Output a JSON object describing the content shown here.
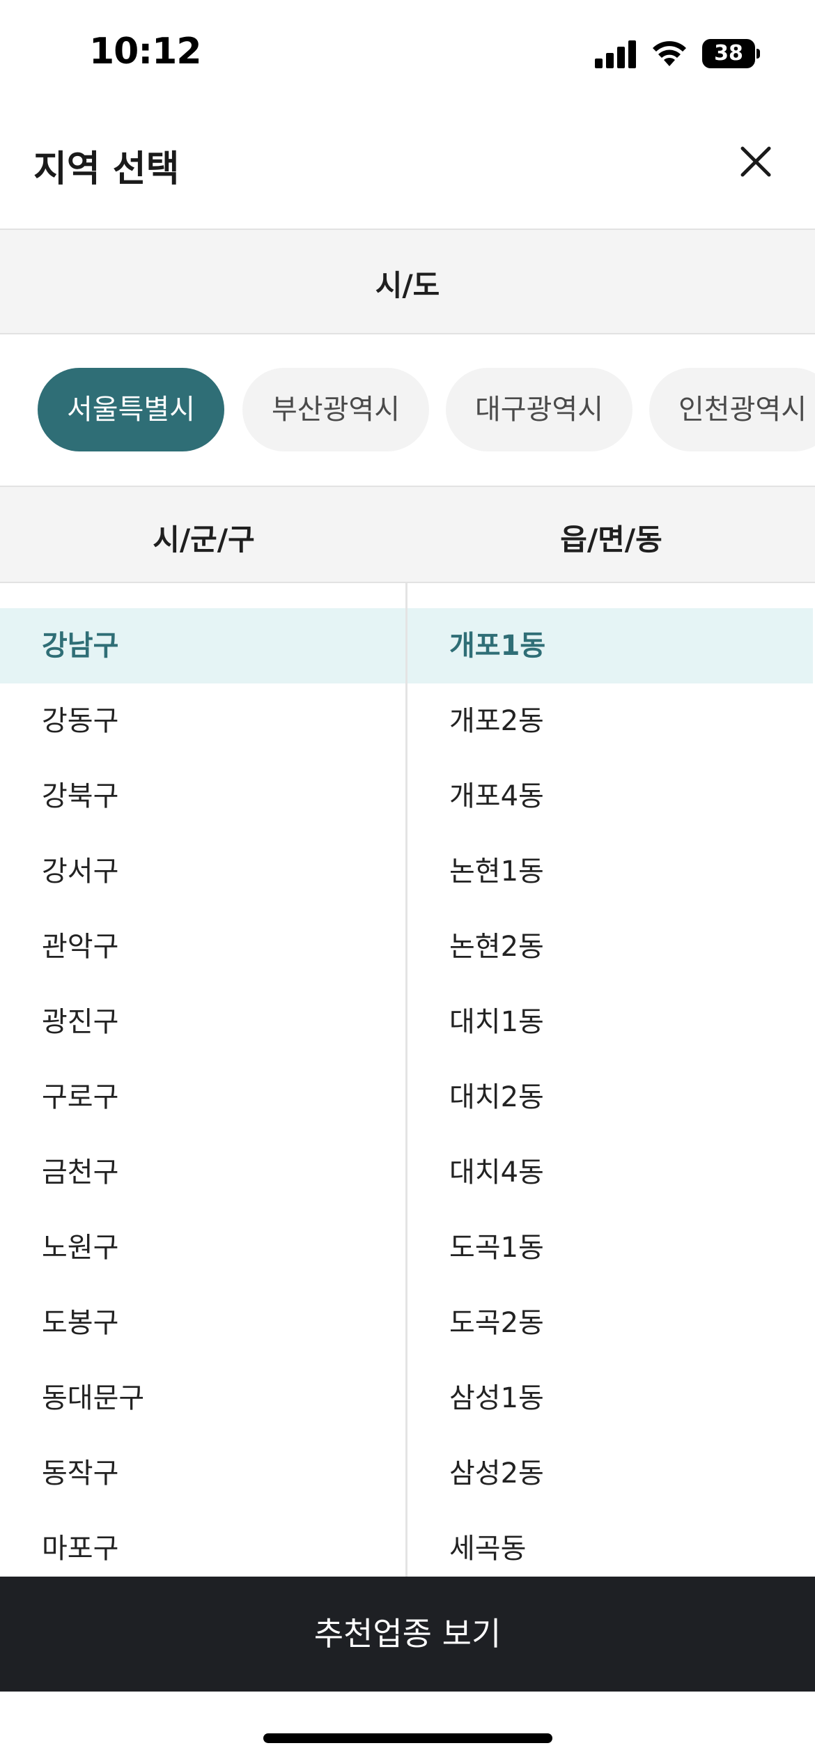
{
  "status_bar": {
    "time": "10:12",
    "battery": "38"
  },
  "header": {
    "title": "지역 선택"
  },
  "sido": {
    "heading": "시/도",
    "chips": [
      {
        "label": "서울특별시",
        "selected": true
      },
      {
        "label": "부산광역시",
        "selected": false
      },
      {
        "label": "대구광역시",
        "selected": false
      },
      {
        "label": "인천광역시",
        "selected": false
      }
    ]
  },
  "columns": {
    "sigungu_heading": "시/군/구",
    "eupmyeondong_heading": "읍/면/동"
  },
  "sigungu": [
    "강남구",
    "강동구",
    "강북구",
    "강서구",
    "관악구",
    "광진구",
    "구로구",
    "금천구",
    "노원구",
    "도봉구",
    "동대문구",
    "동작구",
    "마포구"
  ],
  "eupmyeondong": [
    "개포1동",
    "개포2동",
    "개포4동",
    "논현1동",
    "논현2동",
    "대치1동",
    "대치2동",
    "대치4동",
    "도곡1동",
    "도곡2동",
    "삼성1동",
    "삼성2동",
    "세곡동"
  ],
  "selected_sigungu": "강남구",
  "selected_eupmyeondong": "개포1동",
  "cta": {
    "label": "추천업종 보기"
  },
  "colors": {
    "accent": "#2f6e76",
    "selected_row_bg": "#e5f4f5",
    "cta_bg": "#1e2024"
  }
}
